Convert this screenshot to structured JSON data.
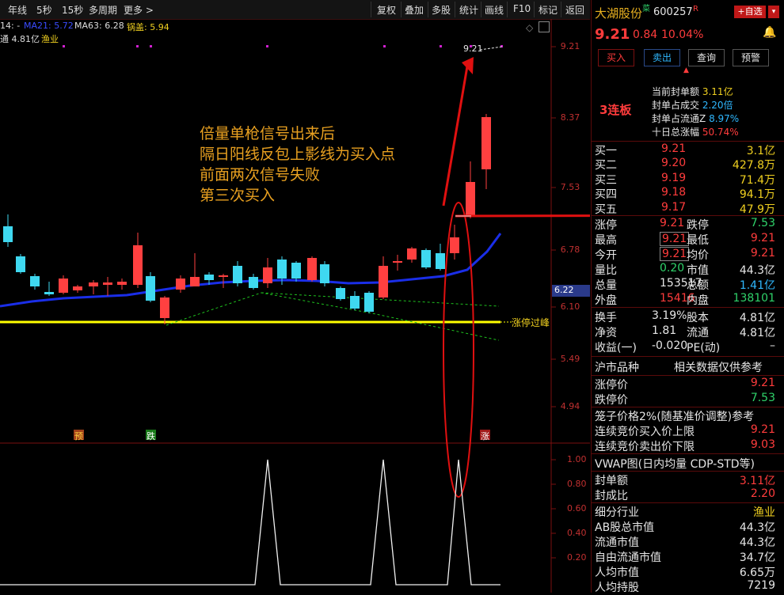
{
  "toolbar": {
    "left": [
      "年线",
      "5秒",
      "15秒",
      "多周期",
      "更多 >"
    ],
    "right": [
      "复权",
      "叠加",
      "多股",
      "统计",
      "画线",
      "F10",
      "标记",
      "返回"
    ]
  },
  "indicator": {
    "ma14": "14: -",
    "ma21": "MA21: 5.72",
    "ma63": "MA63: 6.28",
    "guogai": "锅盖: 5.94",
    "line2": "通 4.81亿",
    "industry": "渔业"
  },
  "price_axis": [
    "9.21",
    "8.37",
    "7.53",
    "6.78",
    "6.10",
    "5.49",
    "4.94"
  ],
  "price_highlight": "6.22",
  "indicator_axis": [
    "1.00",
    "0.80",
    "0.60",
    "0.40",
    "0.20"
  ],
  "chart_labels": {
    "peak_price": "9.21",
    "limit_up_line": "涨停过峰",
    "mark_yu": "预",
    "mark_die": "跌",
    "mark_zhang": "涨"
  },
  "annotation": [
    "倍量单枪信号出来后",
    "隔日阳线反包上影线为买入点",
    "前面两次信号失败",
    "第三次买入"
  ],
  "chart_data": {
    "type": "candlestick",
    "series": [
      {
        "name": "MA21"
      },
      {
        "name": "MA63"
      }
    ],
    "ylim": [
      4.94,
      9.21
    ],
    "colors": {
      "up": "#ff4040",
      "down": "#3fd8f0",
      "ma_blue": "#1a2ee8",
      "limit_line": "#ffff00"
    }
  },
  "stock": {
    "name": "大湖股份",
    "code": "600257",
    "r_flag": "R",
    "fav_btn": "+自选",
    "price": "9.21",
    "change": "0.84",
    "pct": "10.04%",
    "buttons": [
      "买入",
      "卖出",
      "查询",
      "预警"
    ],
    "streak": "3连板",
    "seal_rows": [
      {
        "label": "当前封单额",
        "value": "3.11亿"
      },
      {
        "label": "封单占成交",
        "value": "2.20倍"
      },
      {
        "label": "封单占流通Z",
        "value": "8.97%"
      },
      {
        "label": "十日总涨幅",
        "value": "50.74%"
      }
    ],
    "bids": [
      {
        "label": "买一",
        "price": "9.21",
        "vol": "3.1亿"
      },
      {
        "label": "买二",
        "price": "9.20",
        "vol": "427.8万"
      },
      {
        "label": "买三",
        "price": "9.19",
        "vol": "71.4万"
      },
      {
        "label": "买四",
        "price": "9.18",
        "vol": "94.1万"
      },
      {
        "label": "买五",
        "price": "9.17",
        "vol": "47.9万"
      }
    ],
    "stats": [
      {
        "l1": "涨停",
        "v1": "9.21",
        "l2": "跌停",
        "v2": "7.53"
      },
      {
        "l1": "最高",
        "v1": "9.21",
        "l2": "最低",
        "v2": "9.21"
      },
      {
        "l1": "今开",
        "v1": "9.21",
        "l2": "均价",
        "v2": "9.21"
      },
      {
        "l1": "量比",
        "v1": "0.20",
        "l2": "市值",
        "v2": "44.3亿"
      },
      {
        "l1": "总量",
        "v1": "153517",
        "l2": "总额",
        "v2": "1.41亿"
      },
      {
        "l1": "外盘",
        "v1": "15416",
        "l2": "内盘",
        "v2": "138101"
      }
    ],
    "fund": [
      {
        "l1": "换手",
        "v1": "3.19%",
        "l2": "股本",
        "v2": "4.81亿"
      },
      {
        "l1": "净资",
        "v1": "1.81",
        "l2": "流通",
        "v2": "4.81亿"
      },
      {
        "l1": "收益(一)",
        "v1": "-0.020",
        "l2": "PE(动)",
        "v2": "–"
      }
    ],
    "section1": {
      "left": "沪市品种",
      "right": "相关数据仅供参考"
    },
    "limits": [
      {
        "label": "涨停价",
        "value": "9.21"
      },
      {
        "label": "跌停价",
        "value": "7.53"
      }
    ],
    "cage": "笼子价格2%(随基准价调整)参考",
    "auction": [
      {
        "label": "连续竞价买入价上限",
        "value": "9.21"
      },
      {
        "label": "连续竞价卖出价下限",
        "value": "9.03"
      }
    ],
    "vwap": "VWAP图(日内均量 CDP-STD等)",
    "seal2": [
      {
        "label": "封单额",
        "value": "3.11亿"
      },
      {
        "label": "封成比",
        "value": "2.20"
      }
    ],
    "industry": [
      {
        "label": "细分行业",
        "value": "渔业"
      },
      {
        "label": "AB股总市值",
        "value": "44.3亿"
      },
      {
        "label": "流通市值",
        "value": "44.3亿"
      },
      {
        "label": "自由流通市值",
        "value": "34.7亿"
      },
      {
        "label": "人均市值",
        "value": "6.65万"
      },
      {
        "label": "人均持股",
        "value": "7219"
      }
    ]
  }
}
